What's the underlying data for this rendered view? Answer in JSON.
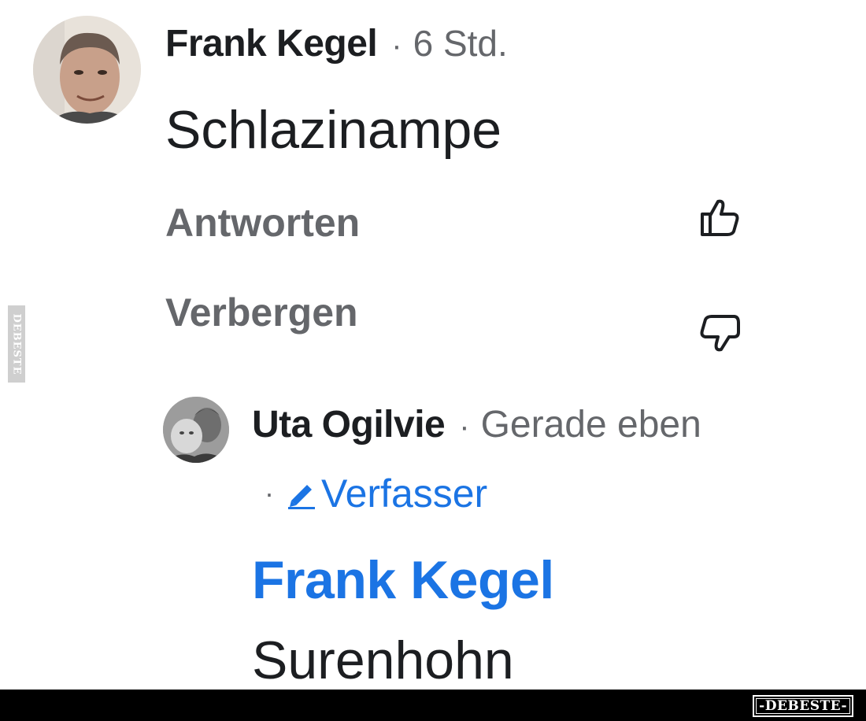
{
  "comments": [
    {
      "author": "Frank Kegel",
      "separator": "·",
      "timestamp": "6 Std.",
      "text": "Schlazinampe",
      "actions": {
        "reply_label": "Antworten",
        "hide_label": "Verbergen"
      },
      "icons": [
        "avatar-photo",
        "thumbs-up-icon",
        "thumbs-down-icon"
      ]
    },
    {
      "author": "Uta Ogilvie",
      "separator": "·",
      "timestamp": "Gerade eben",
      "badge_separator": "·",
      "badge_label": "Verfasser",
      "badge_icon": "pencil-icon",
      "mention": "Frank Kegel",
      "text": "Surenhohn"
    }
  ],
  "watermarks": {
    "side": "DEBESTE",
    "logo": "-DEBESTE-"
  },
  "colors": {
    "name_text": "#1c1e21",
    "meta_text": "#65676b",
    "link_blue": "#1b74e4",
    "bottom_bar": "#000000"
  }
}
